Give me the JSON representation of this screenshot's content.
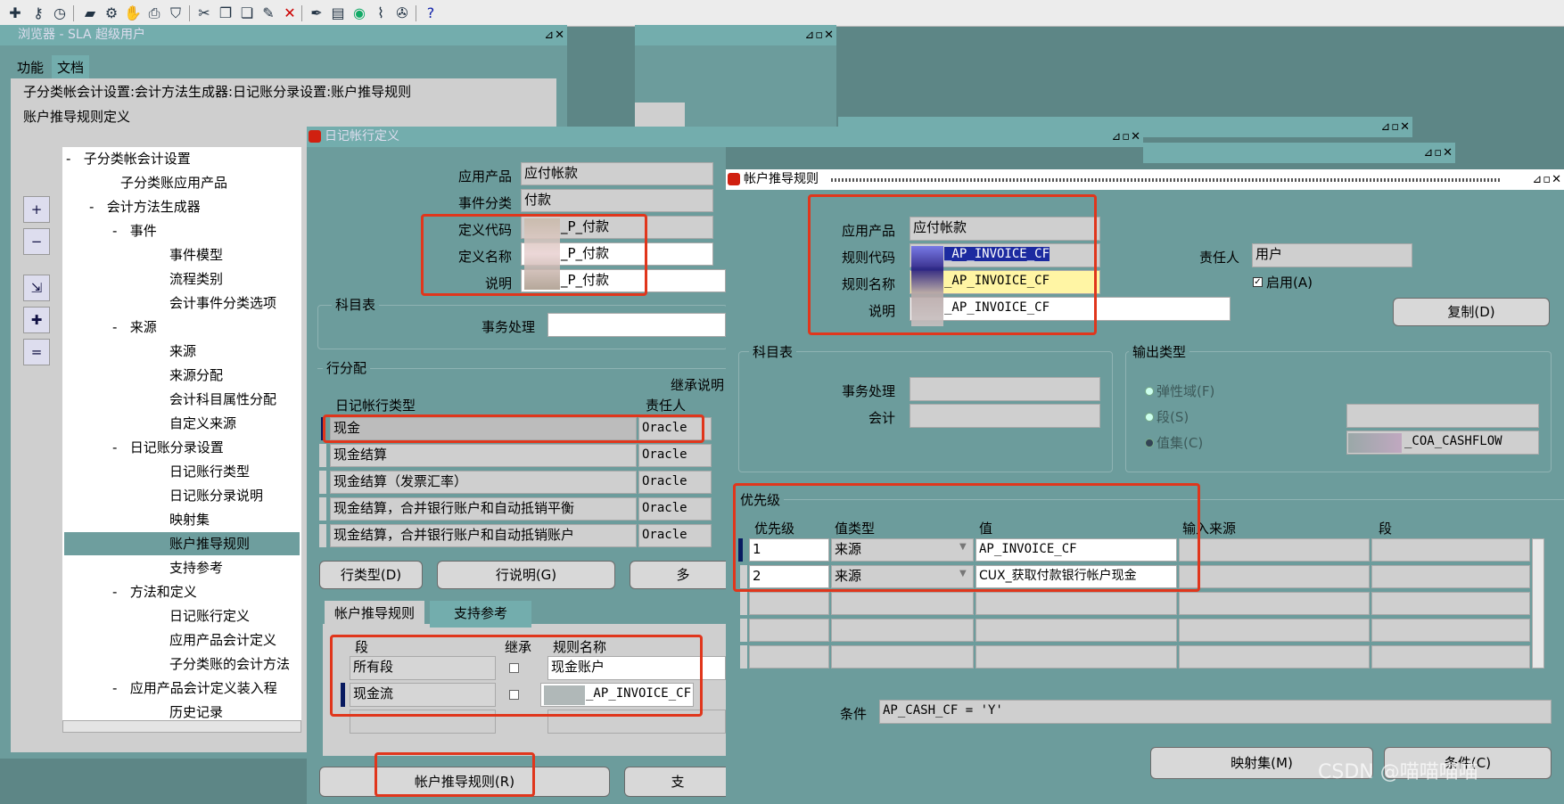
{
  "toolbar": {
    "icons": [
      "new-icon",
      "key-icon",
      "clock-icon",
      "folder-icon",
      "tools-icon",
      "gloves-icon",
      "print-icon",
      "shield-icon",
      "scissors-icon",
      "copy-icon",
      "paste-icon",
      "edit-icon",
      "delete-icon",
      "pen-icon",
      "book-icon",
      "globe-icon",
      "clip-icon",
      "wrench-icon",
      "help-icon"
    ]
  },
  "navigator": {
    "title": "浏览器 - SLA 超级用户",
    "tabs": [
      "功能",
      "文档"
    ],
    "breadcrumb": "子分类帐会计设置:会计方法生成器:日记账分录设置:账户推导规则",
    "subtitle": "账户推导规则定义",
    "tree": [
      {
        "label": "子分类帐会计设置",
        "prefix": "-"
      },
      {
        "label": "子分类账应用产品",
        "prefix": ""
      },
      {
        "label": "会计方法生成器",
        "prefix": "-"
      },
      {
        "label": "事件",
        "prefix": "-"
      },
      {
        "label": "事件模型",
        "prefix": ""
      },
      {
        "label": "流程类别",
        "prefix": ""
      },
      {
        "label": "会计事件分类选项",
        "prefix": ""
      },
      {
        "label": "来源",
        "prefix": "-"
      },
      {
        "label": "来源",
        "prefix": ""
      },
      {
        "label": "来源分配",
        "prefix": ""
      },
      {
        "label": "会计科目属性分配",
        "prefix": ""
      },
      {
        "label": "自定义来源",
        "prefix": ""
      },
      {
        "label": "日记账分录设置",
        "prefix": "-"
      },
      {
        "label": "日记账行类型",
        "prefix": ""
      },
      {
        "label": "日记账分录说明",
        "prefix": ""
      },
      {
        "label": "映射集",
        "prefix": ""
      },
      {
        "label": "账户推导规则",
        "prefix": ""
      },
      {
        "label": "支持参考",
        "prefix": ""
      },
      {
        "label": "方法和定义",
        "prefix": "-"
      },
      {
        "label": "日记账行定义",
        "prefix": ""
      },
      {
        "label": "应用产品会计定义",
        "prefix": ""
      },
      {
        "label": "子分类账的会计方法",
        "prefix": ""
      },
      {
        "label": "应用产品会计定义装入程",
        "prefix": "-"
      },
      {
        "label": "历史记录",
        "prefix": ""
      }
    ]
  },
  "jld": {
    "title": "日记帐行定义",
    "labels": {
      "app": "应用产品",
      "event": "事件分类",
      "code": "定义代码",
      "name": "定义名称",
      "desc": "说明"
    },
    "values": {
      "app": "应付帐款",
      "event": "付款",
      "code": "_P_付款",
      "name": "_P_付款",
      "desc": "_P_付款"
    },
    "coa_group": "科目表",
    "txn_label": "事务处理",
    "line_assign": "行分配",
    "inherit_desc": "继承说明",
    "col_type": "日记帐行类型",
    "col_owner": "责任人",
    "rows": [
      {
        "type": "现金",
        "owner": "Oracle"
      },
      {
        "type": "现金结算",
        "owner": "Oracle"
      },
      {
        "type": "现金结算（发票汇率）",
        "owner": "Oracle"
      },
      {
        "type": "现金结算，合并银行账户和自动抵销平衡",
        "owner": "Oracle"
      },
      {
        "type": "现金结算，合并银行账户和自动抵销账户",
        "owner": "Oracle"
      }
    ],
    "buttons": {
      "line_type": "行类型(D)",
      "line_desc": "行说明(G)",
      "more": "多"
    },
    "tabs": [
      "帐户推导规则",
      "支持参考"
    ],
    "seg_cols": {
      "seg": "段",
      "inherit": "继承",
      "rule": "规则名称"
    },
    "seg_rows": [
      {
        "seg": "所有段",
        "rule": "现金账户"
      },
      {
        "seg": "现金流",
        "rule": "_AP_INVOICE_CF"
      }
    ],
    "bottom_buttons": {
      "adr": "帐户推导规则(R)",
      "sup": "支"
    }
  },
  "adr": {
    "title": "帐户推导规则",
    "labels": {
      "app": "应用产品",
      "code": "规则代码",
      "name": "规则名称",
      "desc": "说明",
      "owner": "责任人",
      "enabled": "启用(A)"
    },
    "values": {
      "app": "应付帐款",
      "code": "_AP_INVOICE_CF",
      "name": "_AP_INVOICE_CF",
      "desc": "_AP_INVOICE_CF",
      "owner": "用户"
    },
    "copy_btn": "复制(D)",
    "coa_group": "科目表",
    "txn_label": "事务处理",
    "acct_label": "会计",
    "output_group": "输出类型",
    "output_opts": [
      "弹性域(F)",
      "段(S)",
      "值集(C)"
    ],
    "valueset": "_COA_CASHFLOW",
    "priority_group": "优先级",
    "cols": {
      "prio": "优先级",
      "vtype": "值类型",
      "value": "值",
      "input": "输入来源",
      "seg": "段"
    },
    "rows": [
      {
        "prio": "1",
        "vtype": "来源",
        "value": "AP_INVOICE_CF"
      },
      {
        "prio": "2",
        "vtype": "来源",
        "value": "CUX_获取付款银行帐户现金"
      }
    ],
    "cond_label": "条件",
    "cond_value": "AP_CASH_CF = 'Y'",
    "mapping_btn": "映射集(M)",
    "cond_btn": "条件(C)"
  },
  "watermark": "CSDN @喵喵喵喵"
}
